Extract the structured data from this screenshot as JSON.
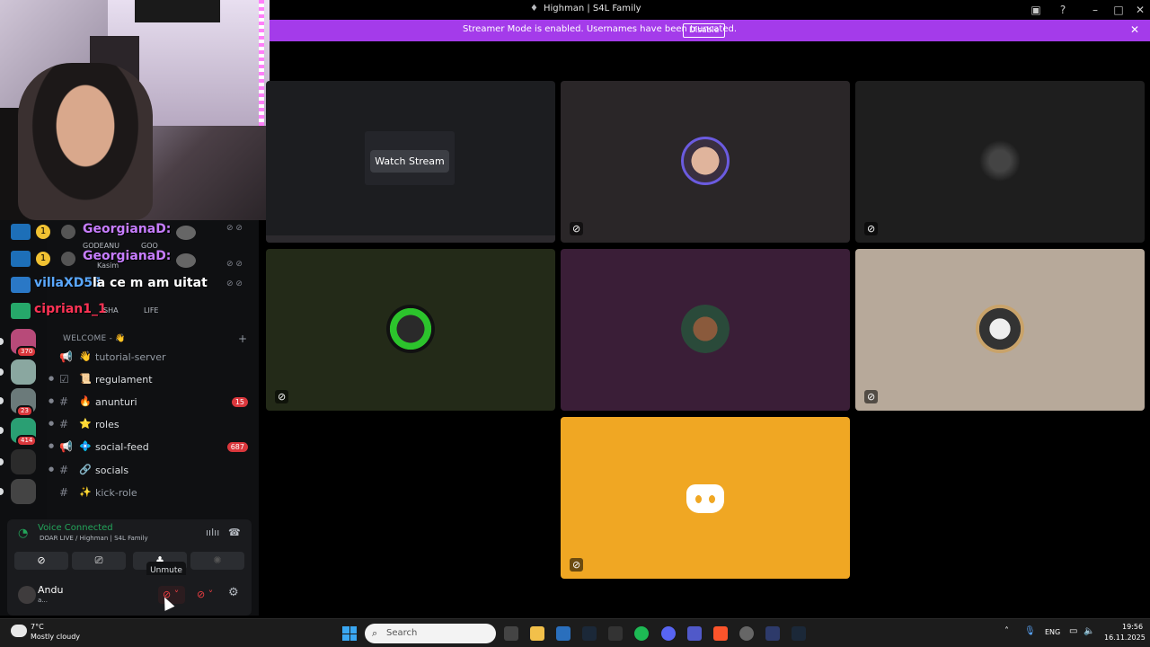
{
  "window": {
    "title": "Highman | S4L Family",
    "title_icon": "server-glyph",
    "controls": [
      "inbox-icon",
      "help-icon",
      "minimize-icon",
      "maximize-icon",
      "close-icon"
    ]
  },
  "banner": {
    "message": "Streamer Mode is enabled. Usernames have been truncated.",
    "disable_label": "Disable",
    "color": "#a43bea"
  },
  "overlay_chat": [
    {
      "name": "GeorgianaD:",
      "sub": "GODEANU",
      "sub2": "GOO"
    },
    {
      "name": "GeorgianaD:",
      "sub": "Kasim"
    },
    {
      "name": "villaXD55",
      "message": "la ce m am uitat"
    },
    {
      "name": "ciprian1_1",
      "sub": "SHA",
      "sub2": "LIFE"
    }
  ],
  "guilds": [
    {
      "badge": "370",
      "color": "#b84a79"
    },
    {
      "badge": "",
      "color": "#8aa7a0"
    },
    {
      "badge": "23",
      "color": "#6b7a7a"
    },
    {
      "badge": "414",
      "color": "#2a9f73"
    },
    {
      "badge": "",
      "color": "#2b2b2b"
    },
    {
      "badge": "",
      "color": "#444"
    }
  ],
  "category": {
    "label": "WELCOME - 👋"
  },
  "channels": [
    {
      "type": "📢",
      "emoji": "👋",
      "name": "tutorial-server",
      "muted": true,
      "count": ""
    },
    {
      "type": "☑",
      "emoji": "📜",
      "name": "regulament",
      "muted": false,
      "count": ""
    },
    {
      "type": "#",
      "emoji": "🔥",
      "name": "anunturi",
      "muted": false,
      "count": "15"
    },
    {
      "type": "#",
      "emoji": "⭐",
      "name": "roles",
      "muted": false,
      "count": ""
    },
    {
      "type": "📢",
      "emoji": "💠",
      "name": "social-feed",
      "muted": false,
      "count": "687"
    },
    {
      "type": "#",
      "emoji": "🔗",
      "name": "socials",
      "muted": false,
      "count": ""
    },
    {
      "type": "#",
      "emoji": "✨",
      "name": "kick-role",
      "muted": true,
      "count": ""
    }
  ],
  "voice": {
    "status": "Voice Connected",
    "channel": "DOAR LIVE / Highman | S4L Family",
    "buttons": [
      "camera-off-icon",
      "screenshare-icon",
      "activities-icon",
      "soundboard-icon"
    ]
  },
  "tooltip": "Unmute",
  "user": {
    "name": "Andu",
    "status": "a..."
  },
  "grid": {
    "watch_stream_label": "Watch Stream",
    "tiles": [
      {
        "id": "stream",
        "bg": "#1c1d20"
      },
      {
        "id": "p1",
        "bg": "#2a2628"
      },
      {
        "id": "p2",
        "bg": "#1e1e1e"
      },
      {
        "id": "p3",
        "bg": "#232a18"
      },
      {
        "id": "p4",
        "bg": "#3a1e37"
      },
      {
        "id": "p5",
        "bg": "#b7a99a"
      },
      {
        "id": "p6",
        "bg": "#f0a723"
      }
    ]
  },
  "taskbar": {
    "temperature": "7°C",
    "condition": "Mostly cloudy",
    "search_placeholder": "Search",
    "language": "ENG",
    "time": "19:56",
    "date": "16.11.2025"
  }
}
